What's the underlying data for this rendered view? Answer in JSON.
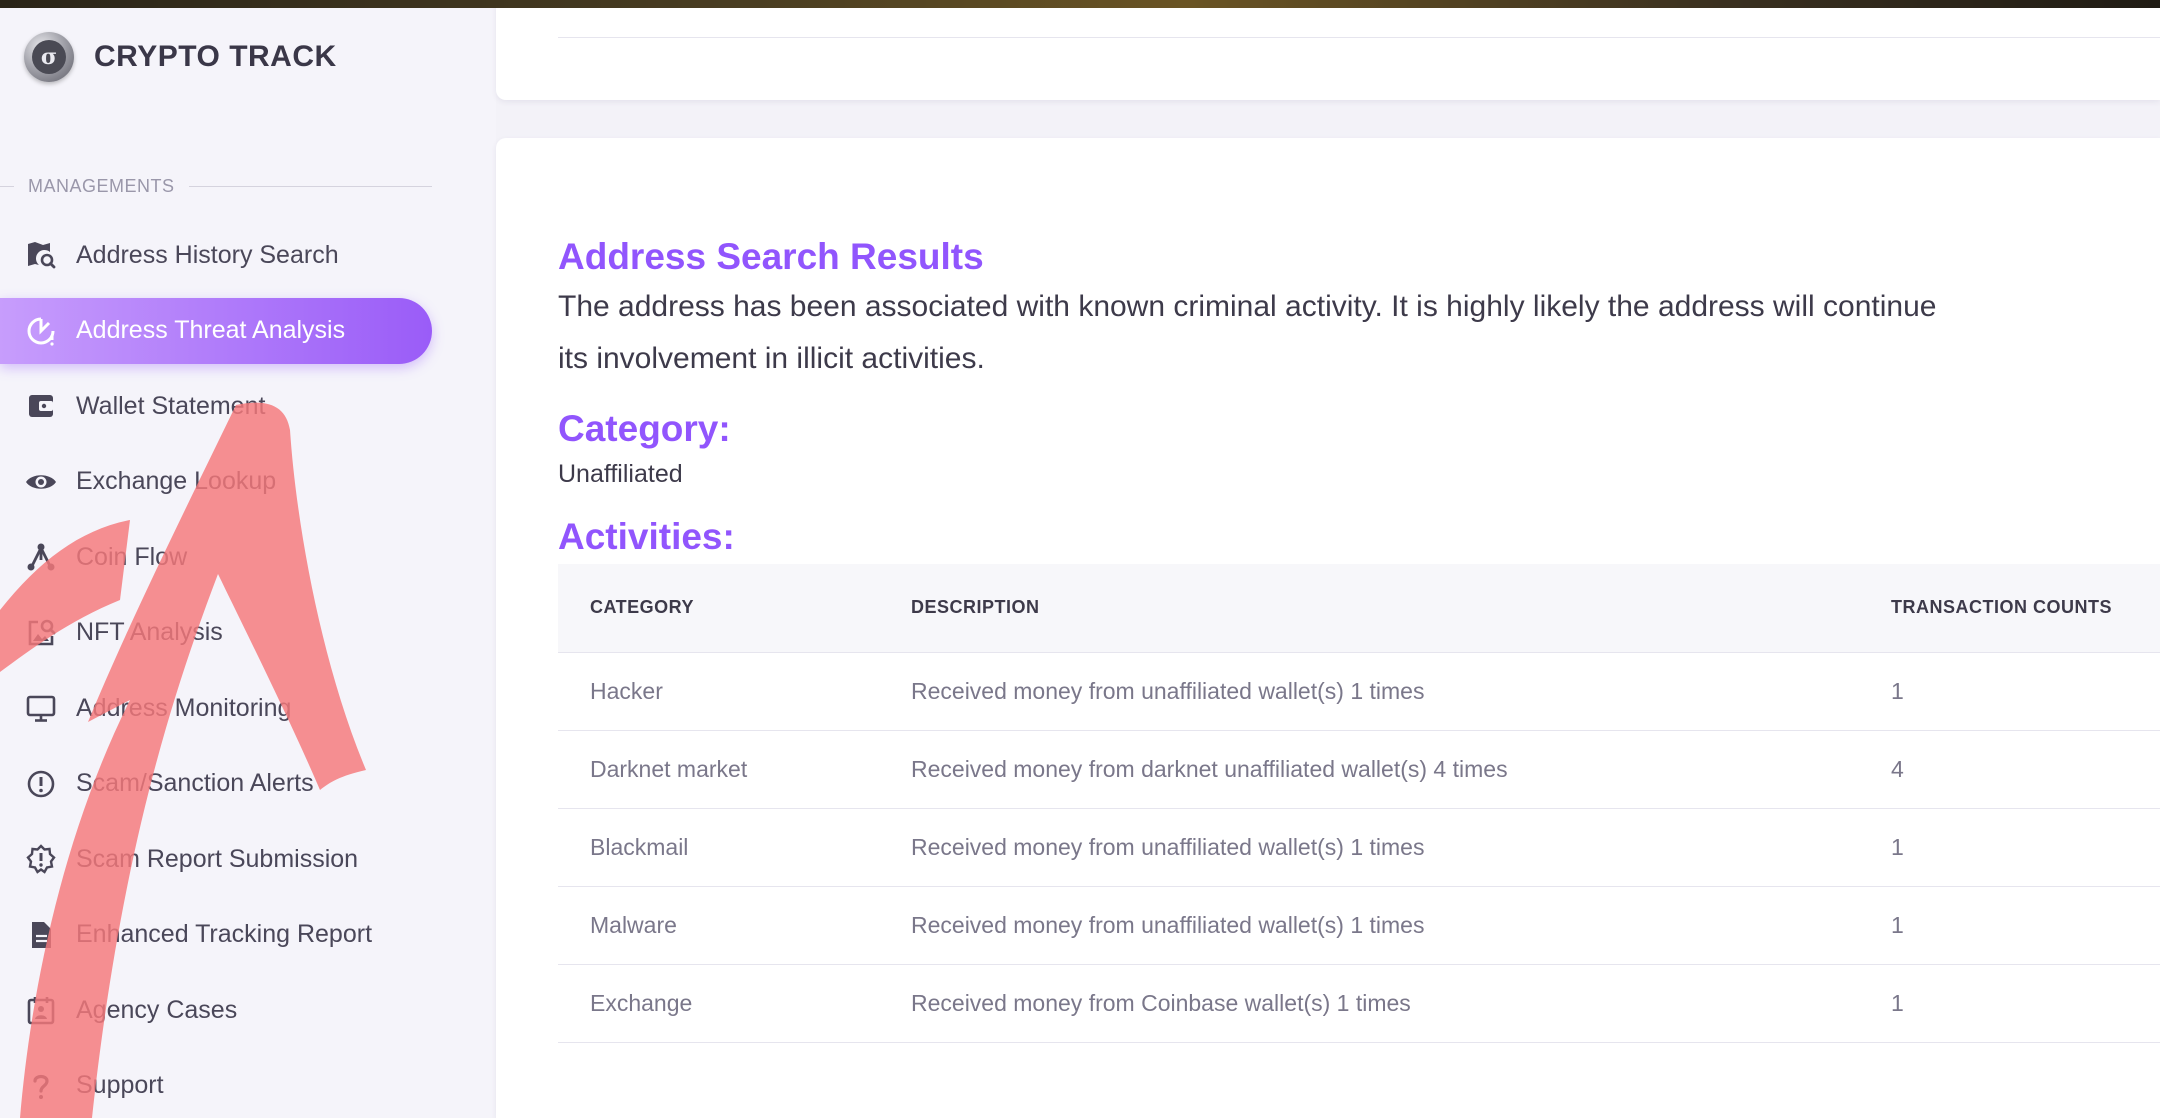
{
  "brand": {
    "name": "CRYPTO TRACK",
    "logo_glyph": "σ"
  },
  "sidebar": {
    "section_label": "MANAGEMENTS",
    "items": [
      {
        "label": "Address History Search",
        "icon": "map-search-icon",
        "active": false
      },
      {
        "label": "Address Threat Analysis",
        "icon": "threat-chart-icon",
        "active": true
      },
      {
        "label": "Wallet Statement",
        "icon": "wallet-icon",
        "active": false
      },
      {
        "label": "Exchange Lookup",
        "icon": "eye-icon",
        "active": false
      },
      {
        "label": "Coin Flow",
        "icon": "flow-icon",
        "active": false
      },
      {
        "label": "NFT Analysis",
        "icon": "image-search-icon",
        "active": false
      },
      {
        "label": "Address Monitoring",
        "icon": "monitor-icon",
        "active": false
      },
      {
        "label": "Scam/Sanction Alerts",
        "icon": "alert-circle-icon",
        "active": false
      },
      {
        "label": "Scam Report Submission",
        "icon": "alert-decagram-icon",
        "active": false
      },
      {
        "label": "Enhanced Tracking Report",
        "icon": "document-icon",
        "active": false
      },
      {
        "label": "Agency Cases",
        "icon": "calendar-account-icon",
        "active": false
      },
      {
        "label": "Support",
        "icon": "question-icon",
        "active": false
      }
    ]
  },
  "results": {
    "title": "Address Search Results",
    "description_line1": "The address has been associated with known criminal activity. It is highly likely the address will continue",
    "description_line2": "its involvement in illicit activities.",
    "category_heading": "Category:",
    "category_value": "Unaffiliated",
    "activities_heading": "Activities:"
  },
  "table": {
    "headers": [
      "CATEGORY",
      "DESCRIPTION",
      "TRANSACTION COUNTS"
    ],
    "rows": [
      {
        "category": "Hacker",
        "description": "Received money from unaffiliated wallet(s) 1 times",
        "count": "1"
      },
      {
        "category": "Darknet market",
        "description": "Received money from darknet unaffiliated wallet(s) 4 times",
        "count": "4"
      },
      {
        "category": "Blackmail",
        "description": "Received money from unaffiliated wallet(s) 1 times",
        "count": "1"
      },
      {
        "category": "Malware",
        "description": "Received money from unaffiliated wallet(s) 1 times",
        "count": "1"
      },
      {
        "category": "Exchange",
        "description": "Received money from Coinbase wallet(s) 1 times",
        "count": "1"
      }
    ]
  },
  "colors": {
    "accent": "#9155fd",
    "active_gradient_start": "#c79dfc",
    "arrow": "#f5787a"
  }
}
